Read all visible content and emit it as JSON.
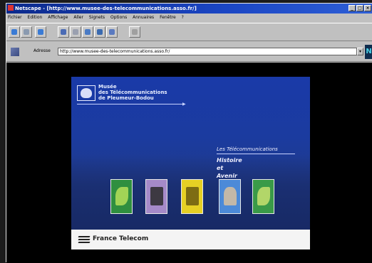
{
  "window": {
    "title": "Netscape - [http://www.musee-des-telecommunications.asso.fr/]",
    "controls": [
      "_",
      "□",
      "×"
    ]
  },
  "menu": [
    "Fichier",
    "Edition",
    "Affichage",
    "Aller",
    "Signets",
    "Options",
    "Annuaires",
    "Fenêtre",
    "?"
  ],
  "toolbar": {
    "buttons": [
      {
        "name": "back-button",
        "icon": "back-arrow-icon",
        "color": "#3a7bd5"
      },
      {
        "name": "forward-button",
        "icon": "forward-arrow-icon",
        "color": "#8a9ab0"
      },
      {
        "name": "home-button",
        "icon": "home-icon",
        "color": "#3a7bd5"
      },
      {
        "name": "reload-button",
        "icon": "reload-icon",
        "color": "#4a6bb5"
      },
      {
        "name": "images-button",
        "icon": "images-icon",
        "color": "#9aa0b0"
      },
      {
        "name": "open-button",
        "icon": "open-icon",
        "color": "#4a7bc5"
      },
      {
        "name": "print-button",
        "icon": "print-icon",
        "color": "#3a6ab0"
      },
      {
        "name": "find-button",
        "icon": "find-icon",
        "color": "#5a7ac0"
      },
      {
        "name": "stop-button",
        "icon": "stop-icon",
        "color": "#a0a0a0"
      }
    ]
  },
  "address": {
    "label": "Adresse",
    "value": "http://www.musee-des-telecommunications.asso.fr/"
  },
  "throbber": {
    "letter": "N"
  },
  "page": {
    "museum_lines": [
      "Musée",
      "des Télécommunications",
      "de Pleumeur-Bodou"
    ],
    "section_title": "Les Télécommunications",
    "tagline": [
      "Histoire",
      "et",
      "Avenir"
    ],
    "thumbnails": [
      {
        "name": "thumb-satellite-dish",
        "bg": "#2f8f3f",
        "accent": "#b6e05a"
      },
      {
        "name": "thumb-old-telephone",
        "bg": "#a58ac8",
        "accent": "#2a2a2a"
      },
      {
        "name": "thumb-antenna-towers",
        "bg": "#e6d024",
        "accent": "#6a5a10"
      },
      {
        "name": "thumb-engineer",
        "bg": "#4c8ad8",
        "accent": "#d8c0a0"
      },
      {
        "name": "thumb-radar-dish",
        "bg": "#3a9a48",
        "accent": "#c8e070"
      }
    ],
    "footer_brand": "France Telecom"
  },
  "colors": {
    "page_blue": "#1f3ea0",
    "titlebar": "#0b2a8c"
  }
}
